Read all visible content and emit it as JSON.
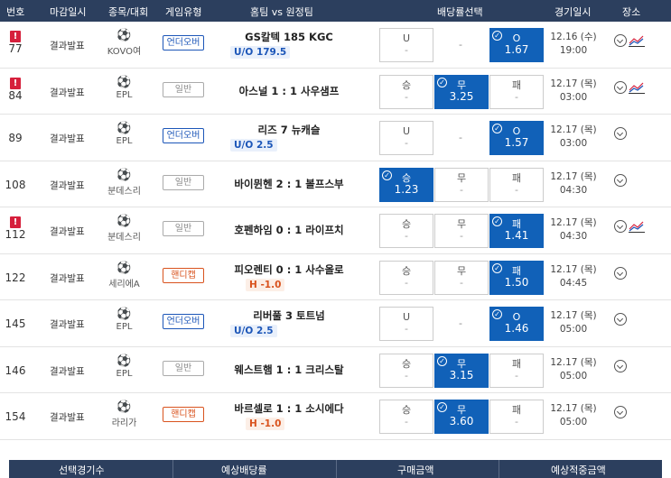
{
  "header": {
    "num": "번호",
    "deadline": "마감일시",
    "sport": "종목/대회",
    "type": "게임유형",
    "match": "홈팀 vs 원정팀",
    "odds": "배당률선택",
    "date": "경기일시",
    "place": "장소"
  },
  "rows": [
    {
      "num": "77",
      "alert": true,
      "deadline": "결과발표",
      "sport_icon": "volleyball-icon",
      "sport": "KOVO여",
      "type": "언더오버",
      "type_kind": "uo",
      "match": "GS칼텍  185  KGC",
      "sub": "U/O 179.5",
      "sub_kind": "uo",
      "b1": {
        "l1": "U",
        "l2": "-",
        "sel": false
      },
      "mid": "-",
      "b3": {
        "l1": "O",
        "l2": "1.67",
        "sel": true
      },
      "date1": "12.16 (수)",
      "date2": "19:00",
      "trend": true
    },
    {
      "num": "84",
      "alert": true,
      "deadline": "결과발표",
      "sport_icon": "soccer-ball-icon",
      "sport": "EPL",
      "type": "일반",
      "type_kind": "normal",
      "match": "아스널 1 : 1 사우샘프",
      "sub": "",
      "sub_kind": "",
      "b1": {
        "l1": "승",
        "l2": "-",
        "sel": false
      },
      "b2": {
        "l1": "무",
        "l2": "3.25",
        "sel": true
      },
      "b3": {
        "l1": "패",
        "l2": "-",
        "sel": false
      },
      "date1": "12.17 (목)",
      "date2": "03:00",
      "trend": true
    },
    {
      "num": "89",
      "alert": false,
      "deadline": "결과발표",
      "sport_icon": "soccer-ball-icon",
      "sport": "EPL",
      "type": "언더오버",
      "type_kind": "uo",
      "match": "리즈    7    뉴캐슬",
      "sub": "U/O 2.5",
      "sub_kind": "uo",
      "b1": {
        "l1": "U",
        "l2": "-",
        "sel": false
      },
      "mid": "-",
      "b3": {
        "l1": "O",
        "l2": "1.57",
        "sel": true
      },
      "date1": "12.17 (목)",
      "date2": "03:00",
      "trend": false
    },
    {
      "num": "108",
      "alert": false,
      "deadline": "결과발표",
      "sport_icon": "soccer-ball-icon",
      "sport": "분데스리",
      "type": "일반",
      "type_kind": "normal",
      "match": "바이뮌헨 2 : 1 볼프스부",
      "sub": "",
      "sub_kind": "",
      "b1": {
        "l1": "승",
        "l2": "1.23",
        "sel": true
      },
      "b2": {
        "l1": "무",
        "l2": "-",
        "sel": false
      },
      "b3": {
        "l1": "패",
        "l2": "-",
        "sel": false
      },
      "date1": "12.17 (목)",
      "date2": "04:30",
      "trend": false
    },
    {
      "num": "112",
      "alert": true,
      "deadline": "결과발표",
      "sport_icon": "soccer-ball-icon",
      "sport": "분데스리",
      "type": "일반",
      "type_kind": "normal",
      "match": "호펜하임 0 : 1 라이프치",
      "sub": "",
      "sub_kind": "",
      "b1": {
        "l1": "승",
        "l2": "-",
        "sel": false
      },
      "b2": {
        "l1": "무",
        "l2": "-",
        "sel": false
      },
      "b3": {
        "l1": "패",
        "l2": "1.41",
        "sel": true
      },
      "date1": "12.17 (목)",
      "date2": "04:30",
      "trend": true
    },
    {
      "num": "122",
      "alert": false,
      "deadline": "결과발표",
      "sport_icon": "soccer-ball-icon",
      "sport": "세리에A",
      "type": "핸디캡",
      "type_kind": "hc",
      "match": "피오렌티 0 : 1 사수올로",
      "sub": "H -1.0",
      "sub_kind": "hc",
      "b1": {
        "l1": "승",
        "l2": "-",
        "sel": false
      },
      "b2": {
        "l1": "무",
        "l2": "-",
        "sel": false
      },
      "b3": {
        "l1": "패",
        "l2": "1.50",
        "sel": true
      },
      "date1": "12.17 (목)",
      "date2": "04:45",
      "trend": false
    },
    {
      "num": "145",
      "alert": false,
      "deadline": "결과발표",
      "sport_icon": "soccer-ball-icon",
      "sport": "EPL",
      "type": "언더오버",
      "type_kind": "uo",
      "match": "리버풀    3    토트넘",
      "sub": "U/O 2.5",
      "sub_kind": "uo",
      "b1": {
        "l1": "U",
        "l2": "-",
        "sel": false
      },
      "mid": "-",
      "b3": {
        "l1": "O",
        "l2": "1.46",
        "sel": true
      },
      "date1": "12.17 (목)",
      "date2": "05:00",
      "trend": false
    },
    {
      "num": "146",
      "alert": false,
      "deadline": "결과발표",
      "sport_icon": "soccer-ball-icon",
      "sport": "EPL",
      "type": "일반",
      "type_kind": "normal",
      "match": "웨스트햄 1 : 1 크리스탈",
      "sub": "",
      "sub_kind": "",
      "b1": {
        "l1": "승",
        "l2": "-",
        "sel": false
      },
      "b2": {
        "l1": "무",
        "l2": "3.15",
        "sel": true
      },
      "b3": {
        "l1": "패",
        "l2": "-",
        "sel": false
      },
      "date1": "12.17 (목)",
      "date2": "05:00",
      "trend": false
    },
    {
      "num": "154",
      "alert": false,
      "deadline": "결과발표",
      "sport_icon": "soccer-ball-icon",
      "sport": "라리가",
      "type": "핸디캡",
      "type_kind": "hc",
      "match": "바르셀로 1 : 1 소시에다",
      "sub": "H -1.0",
      "sub_kind": "hc",
      "b1": {
        "l1": "승",
        "l2": "-",
        "sel": false
      },
      "b2": {
        "l1": "무",
        "l2": "3.60",
        "sel": true
      },
      "b3": {
        "l1": "패",
        "l2": "-",
        "sel": false
      },
      "date1": "12.17 (목)",
      "date2": "05:00",
      "trend": false
    }
  ],
  "footer": {
    "c1": "선택경기수",
    "c2": "예상배당률",
    "c3": "구매금액",
    "c4": "예상적중금액"
  },
  "colors": {
    "header_bg": "#2c3f5e",
    "selected": "#1161b8",
    "alert": "#d6203c",
    "uo": "#1c56b8",
    "handicap": "#d9531e"
  }
}
